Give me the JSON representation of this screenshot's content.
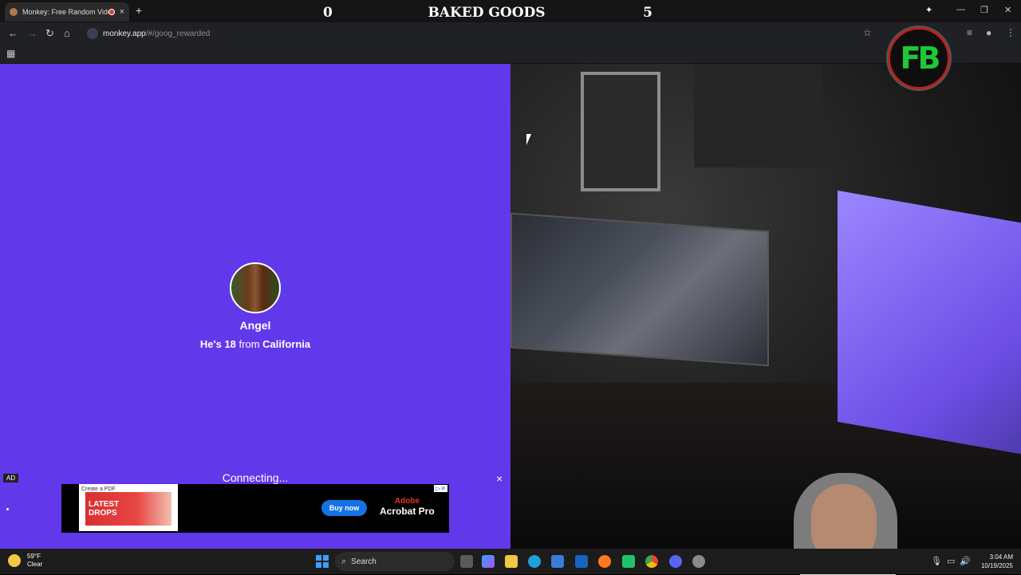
{
  "browser": {
    "tab_title": "Monkey: Free Random Vide",
    "new_tab": "+",
    "close_tab": "×",
    "url_host": "monkey.app",
    "url_path": "/#/goog_rewarded",
    "window_controls": [
      "—",
      "❐",
      "✕"
    ]
  },
  "scoreboard": {
    "left_score": "0",
    "title": "BAKED GOODS",
    "right_score": "5"
  },
  "stream_logo": {
    "text": "FB",
    "accent": "#1ec735",
    "ring": "#b92020"
  },
  "match": {
    "name": "Angel",
    "subtitle_prefix": "He's",
    "age": "18",
    "subtitle_mid": "from",
    "location": "California",
    "status": "Connecting...",
    "background": "#6238eb"
  },
  "ad": {
    "label": "AD",
    "close": "×",
    "frame_caption": "Create a PDF",
    "image_text": "LATEST DROPS",
    "cta": "Buy now",
    "brand_line1": "Adobe",
    "brand_line2": "Acrobat Pro"
  },
  "taskbar": {
    "temperature": "59°F",
    "condition": "Clear",
    "search_placeholder": "Search",
    "time": "3:04 AM",
    "date": "10/19/2025"
  }
}
